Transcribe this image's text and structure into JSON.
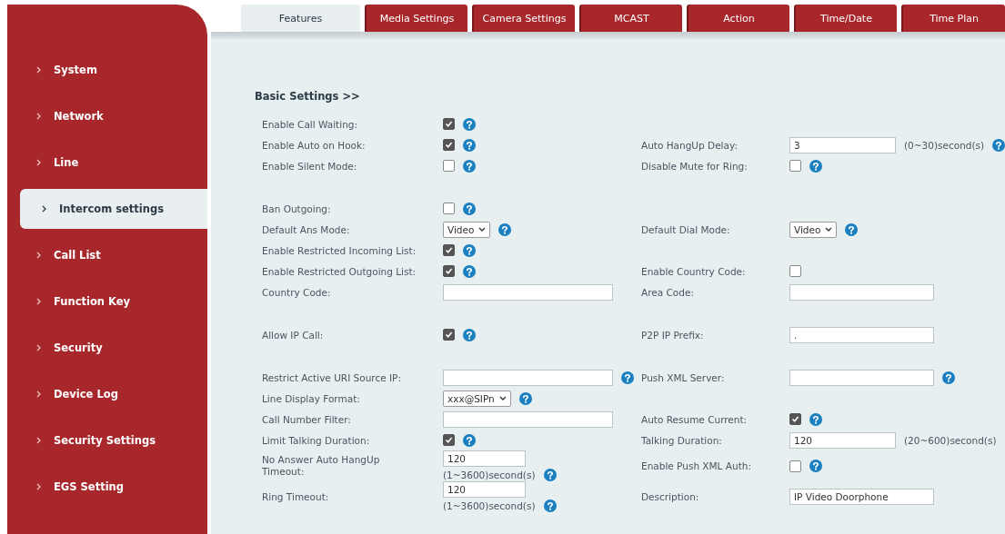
{
  "sidebar": {
    "items": [
      {
        "label": "System",
        "selected": false
      },
      {
        "label": "Network",
        "selected": false
      },
      {
        "label": "Line",
        "selected": false
      },
      {
        "label": "Intercom settings",
        "selected": true
      },
      {
        "label": "Call List",
        "selected": false
      },
      {
        "label": "Function Key",
        "selected": false
      },
      {
        "label": "Security",
        "selected": false
      },
      {
        "label": "Device Log",
        "selected": false
      },
      {
        "label": "Security Settings",
        "selected": false
      },
      {
        "label": "EGS Setting",
        "selected": false
      }
    ]
  },
  "tabs": [
    {
      "label": "Features",
      "selected": true
    },
    {
      "label": "Media Settings",
      "selected": false
    },
    {
      "label": "Camera Settings",
      "selected": false
    },
    {
      "label": "MCAST",
      "selected": false
    },
    {
      "label": "Action",
      "selected": false
    },
    {
      "label": "Time/Date",
      "selected": false
    },
    {
      "label": "Time Plan",
      "selected": false
    }
  ],
  "section_title": "Basic Settings >>",
  "groups": [
    [
      {
        "left": {
          "label": "Enable Call Waiting:",
          "kind": "checkbox",
          "checked": true,
          "help": true
        }
      },
      {
        "left": {
          "label": "Enable Auto on Hook:",
          "kind": "checkbox",
          "checked": true,
          "help": true
        },
        "right": {
          "label": "Auto HangUp Delay:",
          "kind": "input",
          "value": "3",
          "unit": "(0~30)second(s)",
          "help": true
        }
      },
      {
        "left": {
          "label": "Enable Silent Mode:",
          "kind": "checkbox",
          "checked": false,
          "help": true
        },
        "right": {
          "label": "Disable Mute for Ring:",
          "kind": "checkbox",
          "checked": false,
          "help": true
        }
      }
    ],
    [
      {
        "left": {
          "label": "Ban Outgoing:",
          "kind": "checkbox",
          "checked": false,
          "help": true
        }
      },
      {
        "left": {
          "label": "Default Ans Mode:",
          "kind": "select",
          "value": "Video",
          "help": true
        },
        "right": {
          "label": "Default Dial Mode:",
          "kind": "select",
          "value": "Video",
          "help": true
        }
      },
      {
        "left": {
          "label": "Enable Restricted Incoming List:",
          "kind": "checkbox",
          "checked": true,
          "help": true
        }
      },
      {
        "left": {
          "label": "Enable Restricted Outgoing List:",
          "kind": "checkbox",
          "checked": true,
          "help": true
        },
        "right": {
          "label": "Enable Country Code:",
          "kind": "checkbox",
          "checked": false,
          "help": false
        }
      },
      {
        "left": {
          "label": "Country Code:",
          "kind": "input",
          "help": false
        },
        "right": {
          "label": "Area Code:",
          "kind": "input",
          "help": false
        }
      }
    ],
    [
      {
        "left": {
          "label": "Allow IP Call:",
          "kind": "checkbox",
          "checked": true,
          "help": true
        },
        "right": {
          "label": "P2P IP Prefix:",
          "kind": "input",
          "value": ".",
          "help": false
        }
      }
    ],
    [
      {
        "left": {
          "label": "Restrict Active URI Source IP:",
          "kind": "input",
          "help": true
        },
        "right": {
          "label": "Push XML Server:",
          "kind": "input",
          "help": true
        }
      },
      {
        "left": {
          "label": "Line Display Format:",
          "kind": "select",
          "value": "xxx@SIPn",
          "help": true
        }
      },
      {
        "left": {
          "label": "Call Number Filter:",
          "kind": "input",
          "help": false
        },
        "right": {
          "label": "Auto Resume Current:",
          "kind": "checkbox",
          "checked": true,
          "help": true
        }
      },
      {
        "left": {
          "label": "Limit Talking Duration:",
          "kind": "checkbox",
          "checked": true,
          "help": true
        },
        "right": {
          "label": "Talking Duration:",
          "kind": "input",
          "value": "120",
          "unit": "(20~600)second(s)",
          "help": false
        }
      },
      {
        "left": {
          "label": "No Answer Auto HangUp Timeout:",
          "kind": "stacked",
          "value": "120",
          "unit": "(1~3600)second(s)",
          "help": true
        },
        "right": {
          "label": "Enable Push XML Auth:",
          "kind": "checkbox",
          "checked": false,
          "help": true
        }
      },
      {
        "left": {
          "label": "Ring Timeout:",
          "kind": "stacked",
          "value": "120",
          "unit": "(1~3600)second(s)",
          "help": true
        },
        "right": {
          "label": "Description:",
          "kind": "input",
          "value": "IP Video Doorphone",
          "help": false
        }
      }
    ]
  ]
}
